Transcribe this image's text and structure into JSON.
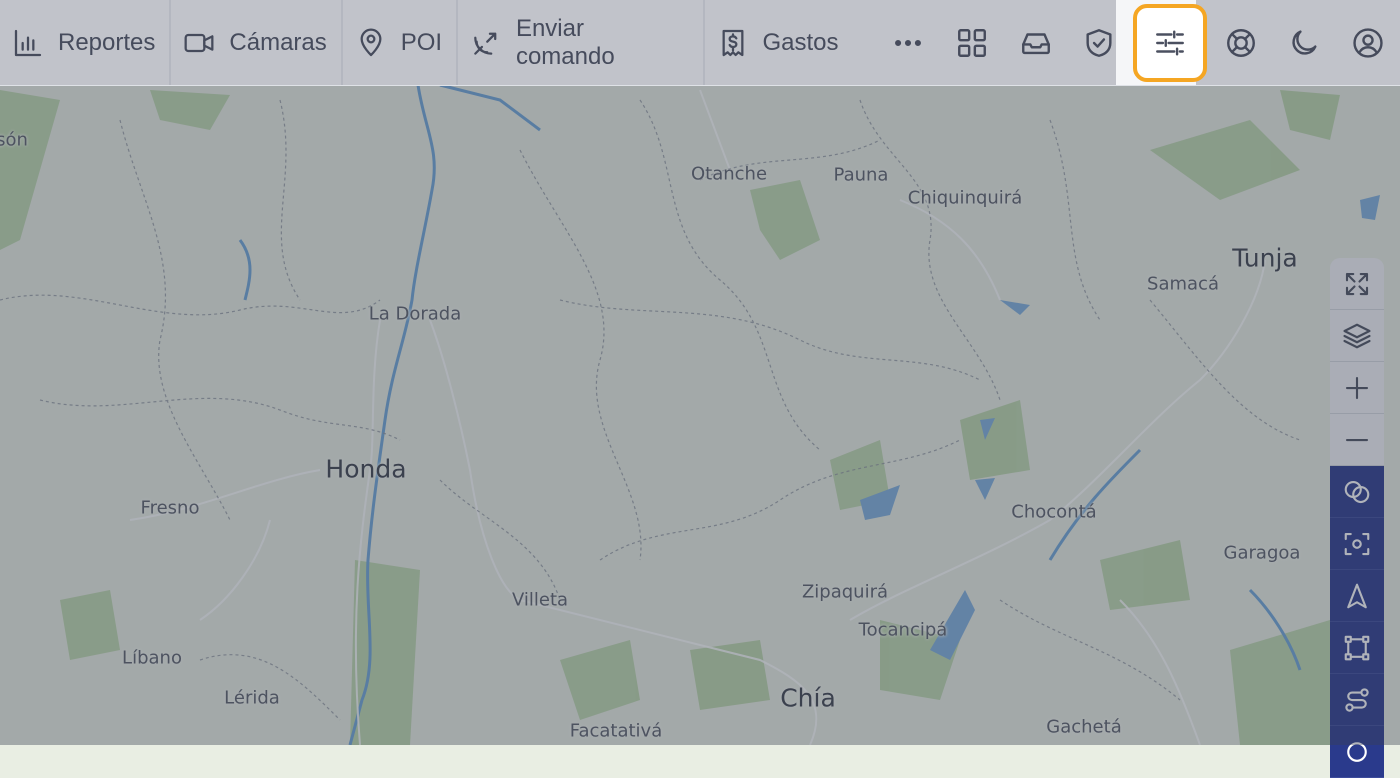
{
  "nav": [
    {
      "label": "Reportes",
      "icon": "bar-chart-icon"
    },
    {
      "label": "Cámaras",
      "icon": "video-camera-icon"
    },
    {
      "label": "POI",
      "icon": "map-pin-icon"
    },
    {
      "label": "Enviar comando",
      "icon": "satellite-dish-icon"
    },
    {
      "label": "Gastos",
      "icon": "receipt-dollar-icon"
    }
  ],
  "toolbar_icons": [
    "more-dots-icon",
    "grid-apps-icon",
    "inbox-icon",
    "shield-check-icon",
    "sliders-icon",
    "lifebuoy-icon",
    "moon-icon",
    "user-avatar-icon"
  ],
  "active_icon": "sliders-icon",
  "accent_color": "#f5a623",
  "rail_dark_color": "#2a3a8c",
  "map_rail": {
    "light": [
      "fullscreen-icon",
      "layers-icon",
      "zoom-in-icon",
      "zoom-out-icon"
    ],
    "dark": [
      "geofence-circles-icon",
      "focus-target-icon",
      "navigation-arrow-icon",
      "polygon-select-icon",
      "route-icon"
    ]
  },
  "places": [
    {
      "name": "són"
    },
    {
      "name": "Otanche"
    },
    {
      "name": "Pauna"
    },
    {
      "name": "Chiquinquirá"
    },
    {
      "name": "Tunja"
    },
    {
      "name": "Samacá"
    },
    {
      "name": "La Dorada"
    },
    {
      "name": "Honda"
    },
    {
      "name": "Fresno"
    },
    {
      "name": "Chocontá"
    },
    {
      "name": "Garagoa"
    },
    {
      "name": "Villeta"
    },
    {
      "name": "Zipaquirá"
    },
    {
      "name": "Tocancipá"
    },
    {
      "name": "Líbano"
    },
    {
      "name": "Lérida"
    },
    {
      "name": "Chía"
    },
    {
      "name": "Facatativá"
    },
    {
      "name": "Gachetá"
    }
  ]
}
